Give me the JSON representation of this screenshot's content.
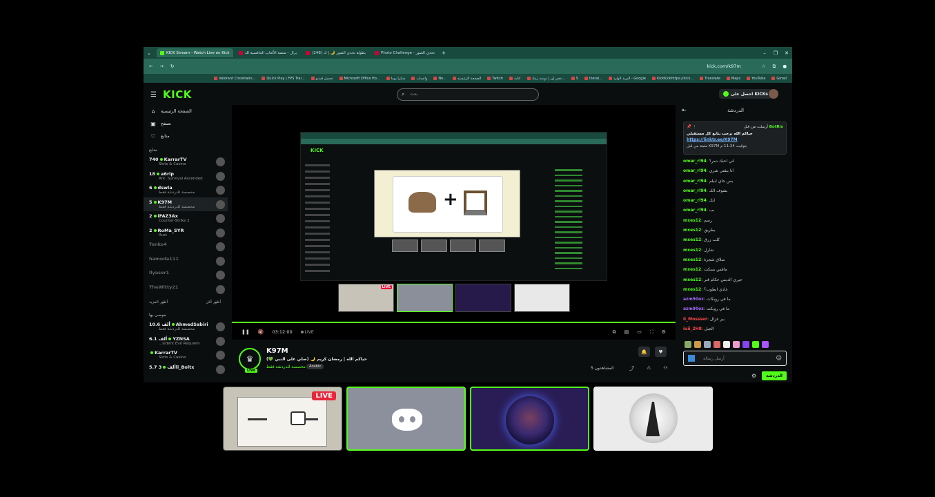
{
  "browser": {
    "tabs": [
      {
        "label": "KICK Stream - Watch Live on Kick",
        "active": true
      },
      {
        "label": "بزال - منصة الألعاب التنافسية لك",
        "active": false
      },
      {
        "label": "(248) بطولة تحدي الصور 🌙 | ك",
        "active": false
      },
      {
        "label": "Photo Challenge - تحدي الصور",
        "active": false
      }
    ],
    "url": "kick.com/k97m",
    "bookmarks": [
      "Valorant Crosshairs...",
      "Quick Play | FPS Trai...",
      "تحميل فيديو",
      "Microsoft Office Ho...",
      "شكرا يوما",
      "واتساب",
      "Ne...",
      "الصفحة الرئيسية",
      "Twitch",
      "كتابة",
      "تغني إن | دونمة زمك...",
      "S",
      "Iberal...",
      "البريد الوارد - Google",
      "KickKickhttps://kick...",
      "Translate",
      "Maps",
      "YouTube",
      "Gmail"
    ]
  },
  "header": {
    "logo": "KICK",
    "search_placeholder": "بحث",
    "get_kicks": "احصل على KICKs"
  },
  "sidebar": {
    "nav": [
      {
        "label": "الصفحة الرئيسية",
        "icon": "home-icon"
      },
      {
        "label": "تصفح",
        "icon": "browse-icon"
      },
      {
        "label": "متابع",
        "icon": "heart-icon"
      }
    ],
    "following_title": "متابع",
    "following": [
      {
        "count": "740",
        "name": "KarrarTV",
        "category": "Slots & Casino",
        "live": true
      },
      {
        "count": "18",
        "name": "a6rip",
        "category": "Ark: Survival Ascended",
        "live": true
      },
      {
        "count": "6",
        "name": "dswla",
        "category": "مخصصة للدردشة فقط",
        "live": true
      },
      {
        "count": "5",
        "name": "K97M",
        "category": "مخصصة للدردشة فقط",
        "live": true,
        "selected": true
      },
      {
        "count": "2",
        "name": "iFAZ3Ax",
        "category": "Counter-Strike 2",
        "live": true
      },
      {
        "count": "2",
        "name": "RoMa_SYR",
        "category": "Rust",
        "live": true
      },
      {
        "count": "",
        "name": "Tonko4",
        "category": "",
        "live": false
      },
      {
        "count": "",
        "name": "hamoda111",
        "category": "",
        "live": false
      },
      {
        "count": "",
        "name": "llyaser1",
        "category": "",
        "live": false
      },
      {
        "count": "",
        "name": "TheWitty21",
        "category": "",
        "live": false
      }
    ],
    "show_more": "أظهر المزيد",
    "show_less": "أظهر أقل",
    "recommended_title": "موصى بها",
    "recommended": [
      {
        "count": "10.6 ألف",
        "name": "AhmedSabiri",
        "category": "مخصصة للدردشة فقط"
      },
      {
        "count": "6.1 ألف",
        "name": "YZNSA",
        "category": "...sident Evil Requiem"
      },
      {
        "count": "",
        "name": "KarrarTV",
        "category": "Slots & Casino"
      },
      {
        "count": "5.7 ألف",
        "name": "3li_Boltx",
        "category": ""
      }
    ]
  },
  "player": {
    "time": "03:12:00",
    "live_label": "LIVE",
    "inner_live": "LIVE"
  },
  "stream": {
    "streamer": "K97M",
    "title": "حياكم الله | رمضان كريم 🌙 (صلي على النبي 💚)",
    "category": "مخصصة للدردشة فقط",
    "language": "Arabic",
    "viewers": "المشاهدون 5",
    "avatar_badge": "LIVE"
  },
  "chat": {
    "title": "الدردشة",
    "pinned_by_label": "أرسلت من قبل",
    "pinned_user": "BotRix",
    "pinned_message": "حياكم الله نرحب بتابع كل مستقبلي",
    "pinned_link": "https://linktr.ee/K97M",
    "pinned_footer": "مثبتة من قبل K97M بتوقيت 11:24 م",
    "messages": [
      {
        "user": "omar_rl94",
        "text": "اني احبك دمر؟",
        "color": "g"
      },
      {
        "user": "omar_rl94",
        "text": "انا ينقني شري",
        "color": "g"
      },
      {
        "user": "omar_rl94",
        "text": "بس جاي ابيلم",
        "color": "g"
      },
      {
        "user": "omar_rl94",
        "text": "بشوف الك",
        "color": "g"
      },
      {
        "user": "omar_rl94",
        "text": "ابك",
        "color": "g"
      },
      {
        "user": "omar_rl94",
        "text": "بب",
        "color": "g"
      },
      {
        "user": "mxes12",
        "text": "رسم",
        "color": "g"
      },
      {
        "user": "mxes12",
        "text": "بطريق",
        "color": "g"
      },
      {
        "user": "mxes12",
        "text": "كلب زرق",
        "color": "g"
      },
      {
        "user": "mxes12",
        "text": "شارل",
        "color": "g"
      },
      {
        "user": "mxes12",
        "text": "صلاق شجرة",
        "color": "g"
      },
      {
        "user": "mxes12",
        "text": "مافس بسكت",
        "color": "g"
      },
      {
        "user": "mxes12",
        "text": "جيري الدبس حكام قبر",
        "color": "g"
      },
      {
        "user": "mxes12",
        "text": "عادي ابطوب؟",
        "color": "g"
      },
      {
        "user": "azm90oz",
        "text": "ما في روبكات",
        "color": "p"
      },
      {
        "user": "azm90oz",
        "text": "ما في روبكت",
        "color": "p"
      },
      {
        "user": "ii_Mossser",
        "text": "بير غزال",
        "color": "r"
      },
      {
        "user": "iuii_2H8",
        "text": "الجبل",
        "color": "r"
      }
    ],
    "input_placeholder": "أرسل رسالة",
    "send_label": "الدردشة"
  },
  "overlay": {
    "live_badge": "LIVE"
  }
}
